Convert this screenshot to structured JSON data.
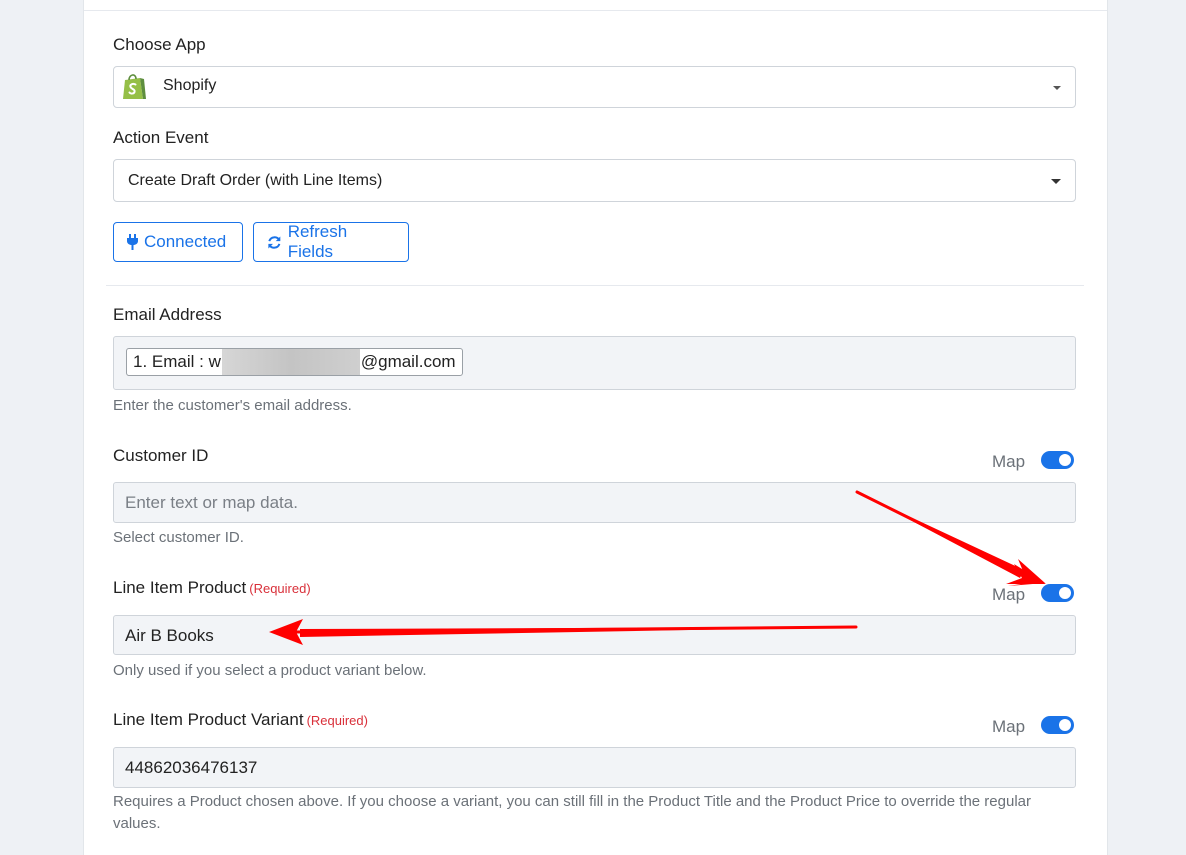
{
  "choose_app": {
    "label": "Choose App",
    "selected": "Shopify",
    "icon": "shopify-bag-icon",
    "brand_color": "#95bf47"
  },
  "action_event": {
    "label": "Action Event",
    "selected": "Create Draft Order (with Line Items)"
  },
  "buttons": {
    "connected": "Connected",
    "refresh": "Refresh Fields",
    "accent_color": "#1a73e8"
  },
  "email": {
    "label": "Email Address",
    "chip_prefix": "1. Email : w",
    "chip_suffix": "@gmail.com",
    "help": "Enter the customer's email address."
  },
  "customer_id": {
    "label": "Customer ID",
    "map_label": "Map",
    "map_on": true,
    "placeholder": "Enter text or map data.",
    "help": "Select customer ID."
  },
  "line_item_product": {
    "label": "Line Item Product",
    "required": "(Required)",
    "map_label": "Map",
    "map_on": true,
    "value": "Air B Books",
    "help": "Only used if you select a product variant below."
  },
  "line_item_variant": {
    "label": "Line Item Product Variant",
    "required": "(Required)",
    "map_label": "Map",
    "map_on": true,
    "value": "44862036476137",
    "help": "Requires a Product chosen above. If you choose a variant, you can still fill in the Product Title and the Product Price to override the regular values."
  },
  "annotation_color": "#ff0000"
}
